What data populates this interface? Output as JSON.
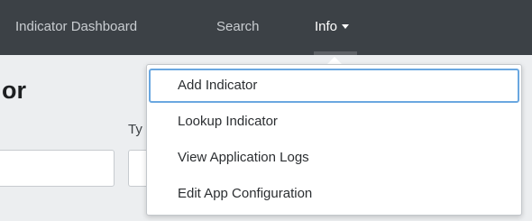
{
  "nav": {
    "items": [
      {
        "label": "Indicator Dashboard"
      },
      {
        "label": "Search"
      },
      {
        "label": "Info",
        "icon": "chevron-down-icon",
        "active": true
      }
    ]
  },
  "page": {
    "title_fragment": "or",
    "type_label_fragment": "Ty"
  },
  "info_menu": {
    "items": [
      {
        "label": "Add Indicator",
        "focused": true
      },
      {
        "label": "Lookup Indicator"
      },
      {
        "label": "View Application Logs"
      },
      {
        "label": "Edit App Configuration"
      }
    ]
  },
  "colors": {
    "nav_background": "#3c4146",
    "nav_text": "#c9cdd1",
    "content_background": "#eceef0",
    "focus_ring": "#6aa7e0"
  }
}
